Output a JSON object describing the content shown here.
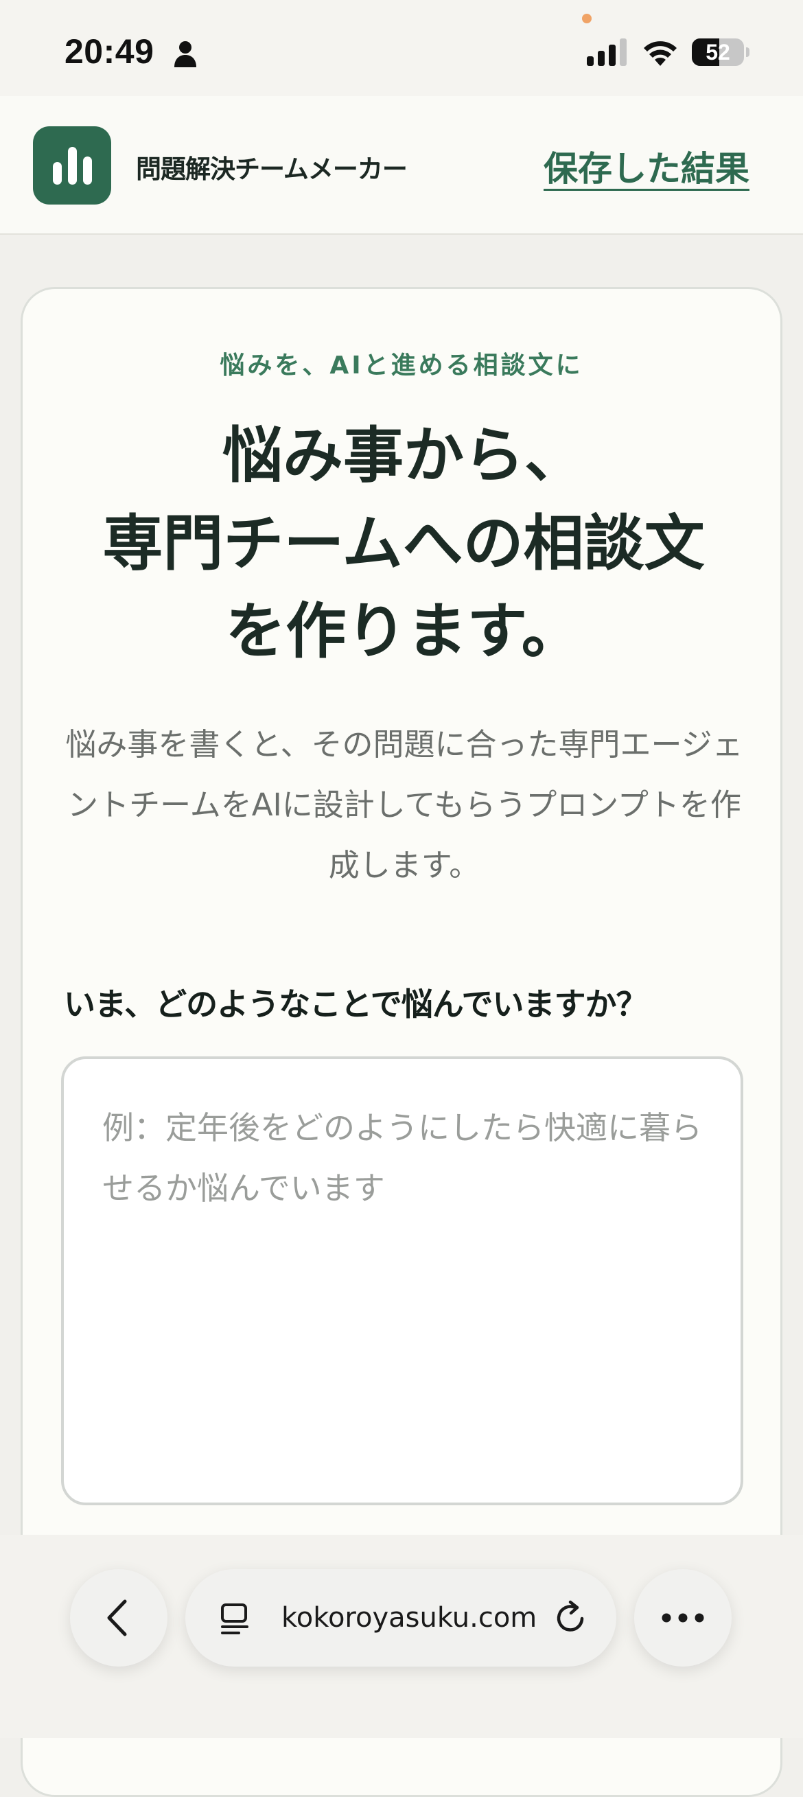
{
  "status_bar": {
    "time": "20:49",
    "battery_level": "52",
    "icons": [
      "person-icon",
      "signal-icon",
      "wifi-icon",
      "battery-icon"
    ]
  },
  "header": {
    "app_title": "問題解決チームメーカー",
    "saved_results_link": "保存した結果",
    "logo_icon": "bar-chart-icon",
    "brand_color": "#2e6a50"
  },
  "hero": {
    "eyebrow": "悩みを、AIと進める相談文に",
    "headline_lines": [
      "悩み事から、",
      "専門チームへの相談文",
      "を作ります。"
    ],
    "description": "悩み事を書くと、その問題に合った専門エージェントチームをAIに設計してもらうプロンプトを作成します。"
  },
  "form": {
    "question_label": "いま、どのようなことで悩んでいますか？",
    "textarea_value": "",
    "textarea_placeholder": "例：定年後をどのようにしたら快適に暮らせるか悩んでいます"
  },
  "browser_toolbar": {
    "url": "kokoroyasuku.com",
    "icons": [
      "back-chevron-icon",
      "reader-icon",
      "reload-icon",
      "more-icon"
    ]
  }
}
